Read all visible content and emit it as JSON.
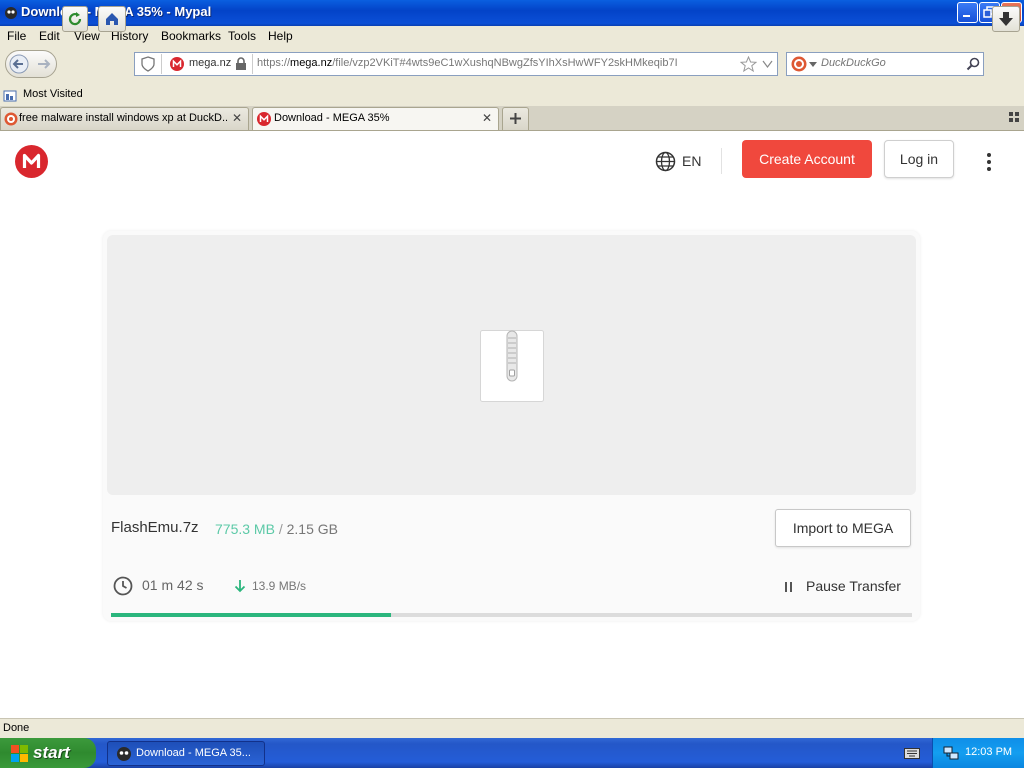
{
  "window": {
    "title": "Download - MEGA 35% - Mypal"
  },
  "menu": [
    "File",
    "Edit",
    "View",
    "History",
    "Bookmarks",
    "Tools",
    "Help"
  ],
  "nav": {
    "site_label": "mega.nz",
    "url_prefix": "https://",
    "url_domain": "mega.nz",
    "url_path": "/file/vzp2VKiT#4wts9eC1wXushqNBwgZfsYIhXsHwWFY2skHMkeqib7I",
    "search_placeholder": "DuckDuckGo"
  },
  "bookmarks": {
    "most_visited": "Most Visited"
  },
  "tabs": [
    {
      "label": "free malware install windows xp at DuckD...",
      "active": false
    },
    {
      "label": "Download - MEGA 35%",
      "active": true
    }
  ],
  "header": {
    "language": "EN",
    "create_account": "Create Account",
    "login": "Log in"
  },
  "file": {
    "name": "FlashEmu.7z",
    "downloaded": "775.3 MB",
    "separator": "/",
    "total": "2.15 GB",
    "import_label": "Import to MEGA",
    "time_min": "01",
    "min_unit": "m",
    "time_sec": "42",
    "sec_unit": "s",
    "speed": "13.9 MB/s",
    "pause_label": "Pause Transfer",
    "progress": 0.35
  },
  "colors": {
    "brand": "#d9272e",
    "create": "#f0483d",
    "progress": "#2bb67d",
    "downloaded": "#5cc9a7"
  },
  "status": {
    "text": "Done"
  },
  "taskbar": {
    "start": "start",
    "task_label": "Download - MEGA 35...",
    "clock": "12:03 PM"
  }
}
